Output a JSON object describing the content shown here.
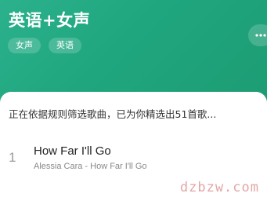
{
  "playlist": {
    "title": "英语+女声",
    "tags": [
      "女声",
      "英语"
    ]
  },
  "status_text": "正在依据规则筛选歌曲，已为你精选出51首歌...",
  "songs": [
    {
      "index": "1",
      "title": "How Far I'll Go",
      "subtitle": "Alessia Cara - How Far I'll Go"
    }
  ],
  "watermark": "dzbzw.com",
  "colors": {
    "header_bg": "#1fa67e",
    "accent": "#2bb18c",
    "watermark": "#e3a6a6"
  },
  "icons": {
    "more": "more-dots-icon"
  }
}
